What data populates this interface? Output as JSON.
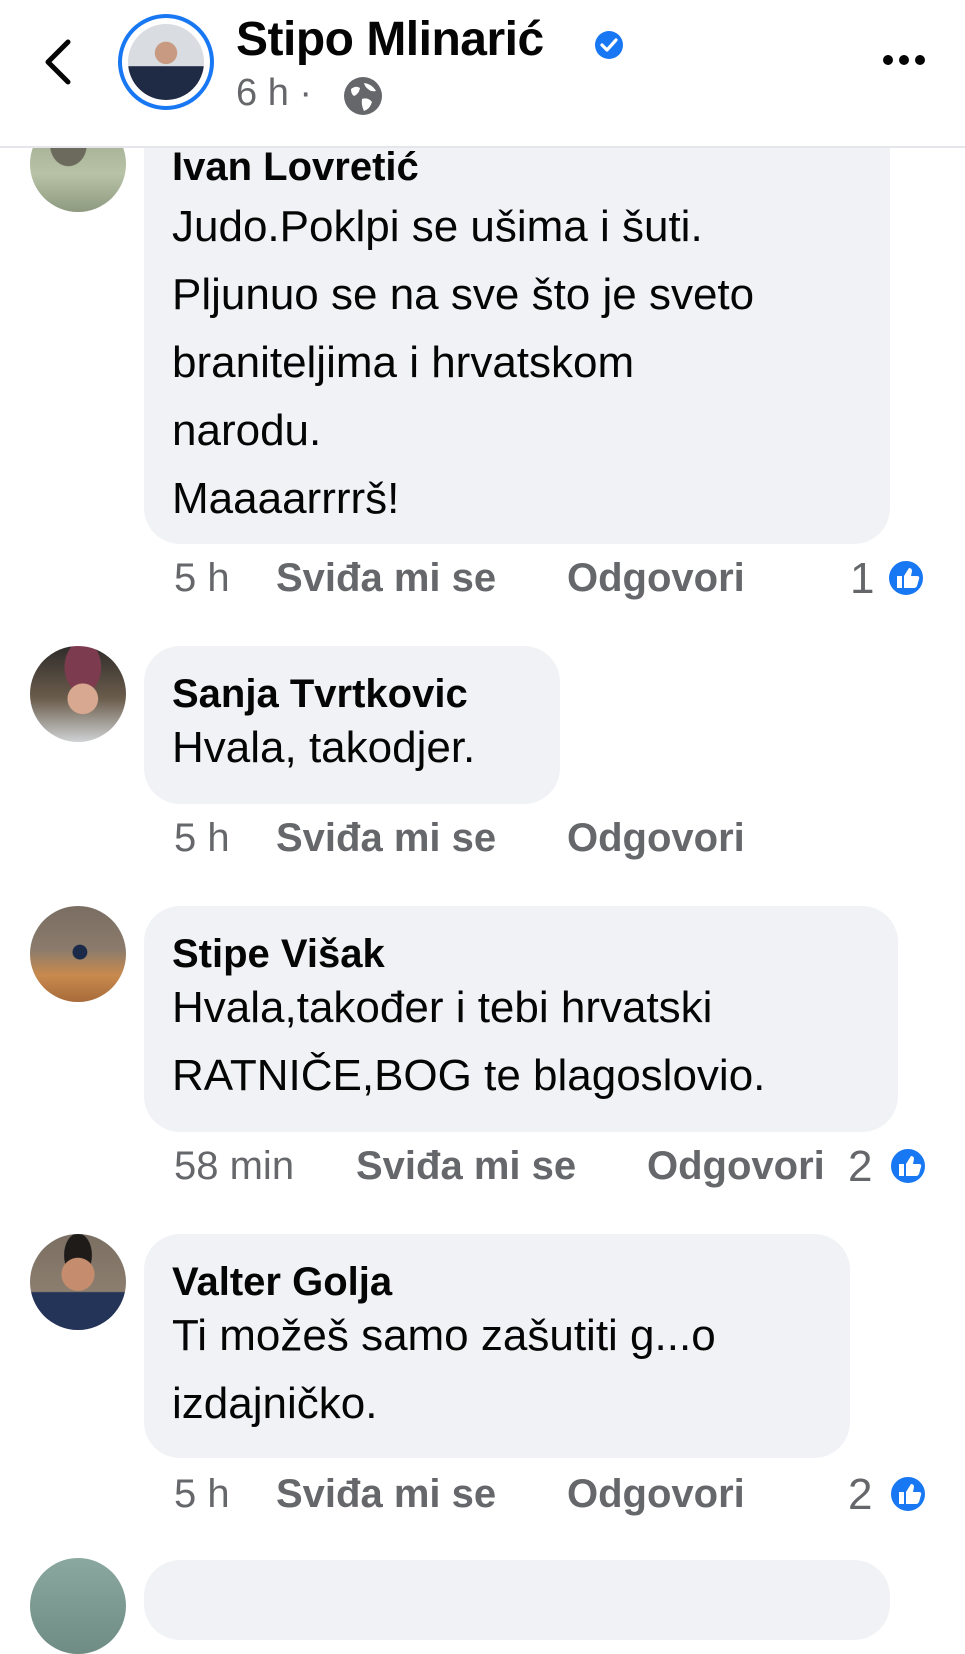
{
  "header": {
    "author_name": "Stipo Mlinarić",
    "time": "6 h",
    "separator": "·",
    "back_icon": "chevron-left-icon",
    "privacy_icon": "globe-icon",
    "more_icon": "more-options-icon"
  },
  "comments": [
    {
      "name": "Ivan Lovretić",
      "lines": [
        "Judo.Poklpi se ušima i šuti.",
        "Pljunuo se na sve što je sveto",
        "braniteljima i hrvatskom",
        "narodu.",
        "Maaaarrrrš!"
      ],
      "time": "5 h",
      "like_label": "Sviđa mi se",
      "reply_label": "Odgovori",
      "likes": "1"
    },
    {
      "name": "Sanja Tvrtkovic",
      "lines": [
        "Hvala, takodjer."
      ],
      "time": "5 h",
      "like_label": "Sviđa mi se",
      "reply_label": "Odgovori"
    },
    {
      "name": "Stipe Višak",
      "lines": [
        "Hvala,također i tebi hrvatski",
        "RATNIČE,BOG te blagoslovio."
      ],
      "time": "58 min",
      "like_label": "Sviđa mi se",
      "reply_label": "Odgovori",
      "likes": "2"
    },
    {
      "name": "Valter Golja",
      "lines": [
        "Ti možeš samo zašutiti g...o",
        "izdajničko."
      ],
      "time": "5 h",
      "like_label": "Sviđa mi se",
      "reply_label": "Odgovori",
      "likes": "2"
    }
  ],
  "colors": {
    "accent": "#1877f2",
    "bubble": "#f0f2f5",
    "secondary_text": "#65676b"
  }
}
